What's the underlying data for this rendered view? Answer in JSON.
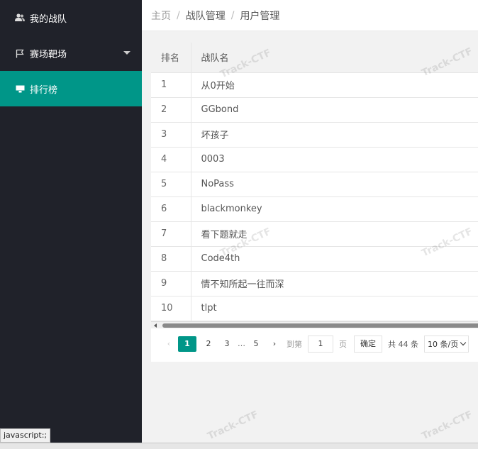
{
  "sidebar": {
    "items": [
      {
        "label": "我的战队",
        "icon": "users-icon"
      },
      {
        "label": "赛场靶场",
        "icon": "flag-icon"
      },
      {
        "label": "排行榜",
        "icon": "monitor-icon"
      }
    ]
  },
  "breadcrumb": {
    "home": "主页",
    "sep": "/",
    "level1": "战队管理",
    "level2": "用户管理"
  },
  "table": {
    "headers": {
      "rank": "排名",
      "name": "战队名"
    },
    "rows": [
      {
        "rank": "1",
        "name": "从0开始"
      },
      {
        "rank": "2",
        "name": "GGbond"
      },
      {
        "rank": "3",
        "name": "坏孩子"
      },
      {
        "rank": "4",
        "name": "0003"
      },
      {
        "rank": "5",
        "name": "NoPass"
      },
      {
        "rank": "6",
        "name": "blackmonkey"
      },
      {
        "rank": "7",
        "name": "看下题就走"
      },
      {
        "rank": "8",
        "name": "Code4th"
      },
      {
        "rank": "9",
        "name": "情不知所起一往而深"
      },
      {
        "rank": "10",
        "name": "tlpt"
      }
    ]
  },
  "pagination": {
    "prev": "‹",
    "pages": [
      "1",
      "2",
      "3",
      "5"
    ],
    "ellipsis": "…",
    "next": "›",
    "goto_label": "到第",
    "goto_value": "1",
    "page_unit": "页",
    "confirm": "确定",
    "total": "共 44 条",
    "page_size": "10 条/页"
  },
  "status_bar": "javascript:;",
  "watermark": "Track-CTF",
  "colors": {
    "accent": "#009688",
    "sidebar_bg": "#20222a"
  }
}
